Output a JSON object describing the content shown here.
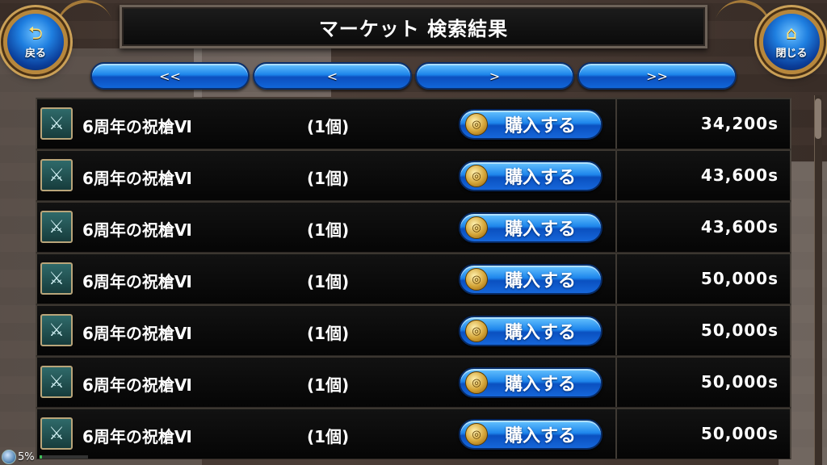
{
  "header": {
    "title": "マーケット 検索結果",
    "back_label": "戻る",
    "close_label": "閉じる"
  },
  "pager": [
    {
      "label": "<<"
    },
    {
      "label": "<"
    },
    {
      "label": ">"
    },
    {
      "label": ">>"
    }
  ],
  "listings": [
    {
      "name": "6周年の祝槍Ⅵ",
      "qty": "(1個)",
      "buy_label": "購入する",
      "price": "34,200s"
    },
    {
      "name": "6周年の祝槍Ⅵ",
      "qty": "(1個)",
      "buy_label": "購入する",
      "price": "43,600s"
    },
    {
      "name": "6周年の祝槍Ⅵ",
      "qty": "(1個)",
      "buy_label": "購入する",
      "price": "43,600s"
    },
    {
      "name": "6周年の祝槍Ⅵ",
      "qty": "(1個)",
      "buy_label": "購入する",
      "price": "50,000s"
    },
    {
      "name": "6周年の祝槍Ⅵ",
      "qty": "(1個)",
      "buy_label": "購入する",
      "price": "50,000s"
    },
    {
      "name": "6周年の祝槍Ⅵ",
      "qty": "(1個)",
      "buy_label": "購入する",
      "price": "50,000s"
    },
    {
      "name": "6周年の祝槍Ⅵ",
      "qty": "(1個)",
      "buy_label": "購入する",
      "price": "50,000s"
    }
  ],
  "status": {
    "percent": "5%",
    "progress_fraction": 0.05
  },
  "colors": {
    "button_blue": "#1c84ea",
    "frame_gold": "#b7873c",
    "row_bg": "#0a0a0a"
  },
  "icons": {
    "back": "back-arrow-icon",
    "close": "home-icon",
    "item": "spear-icon",
    "coin": "coin-icon"
  }
}
